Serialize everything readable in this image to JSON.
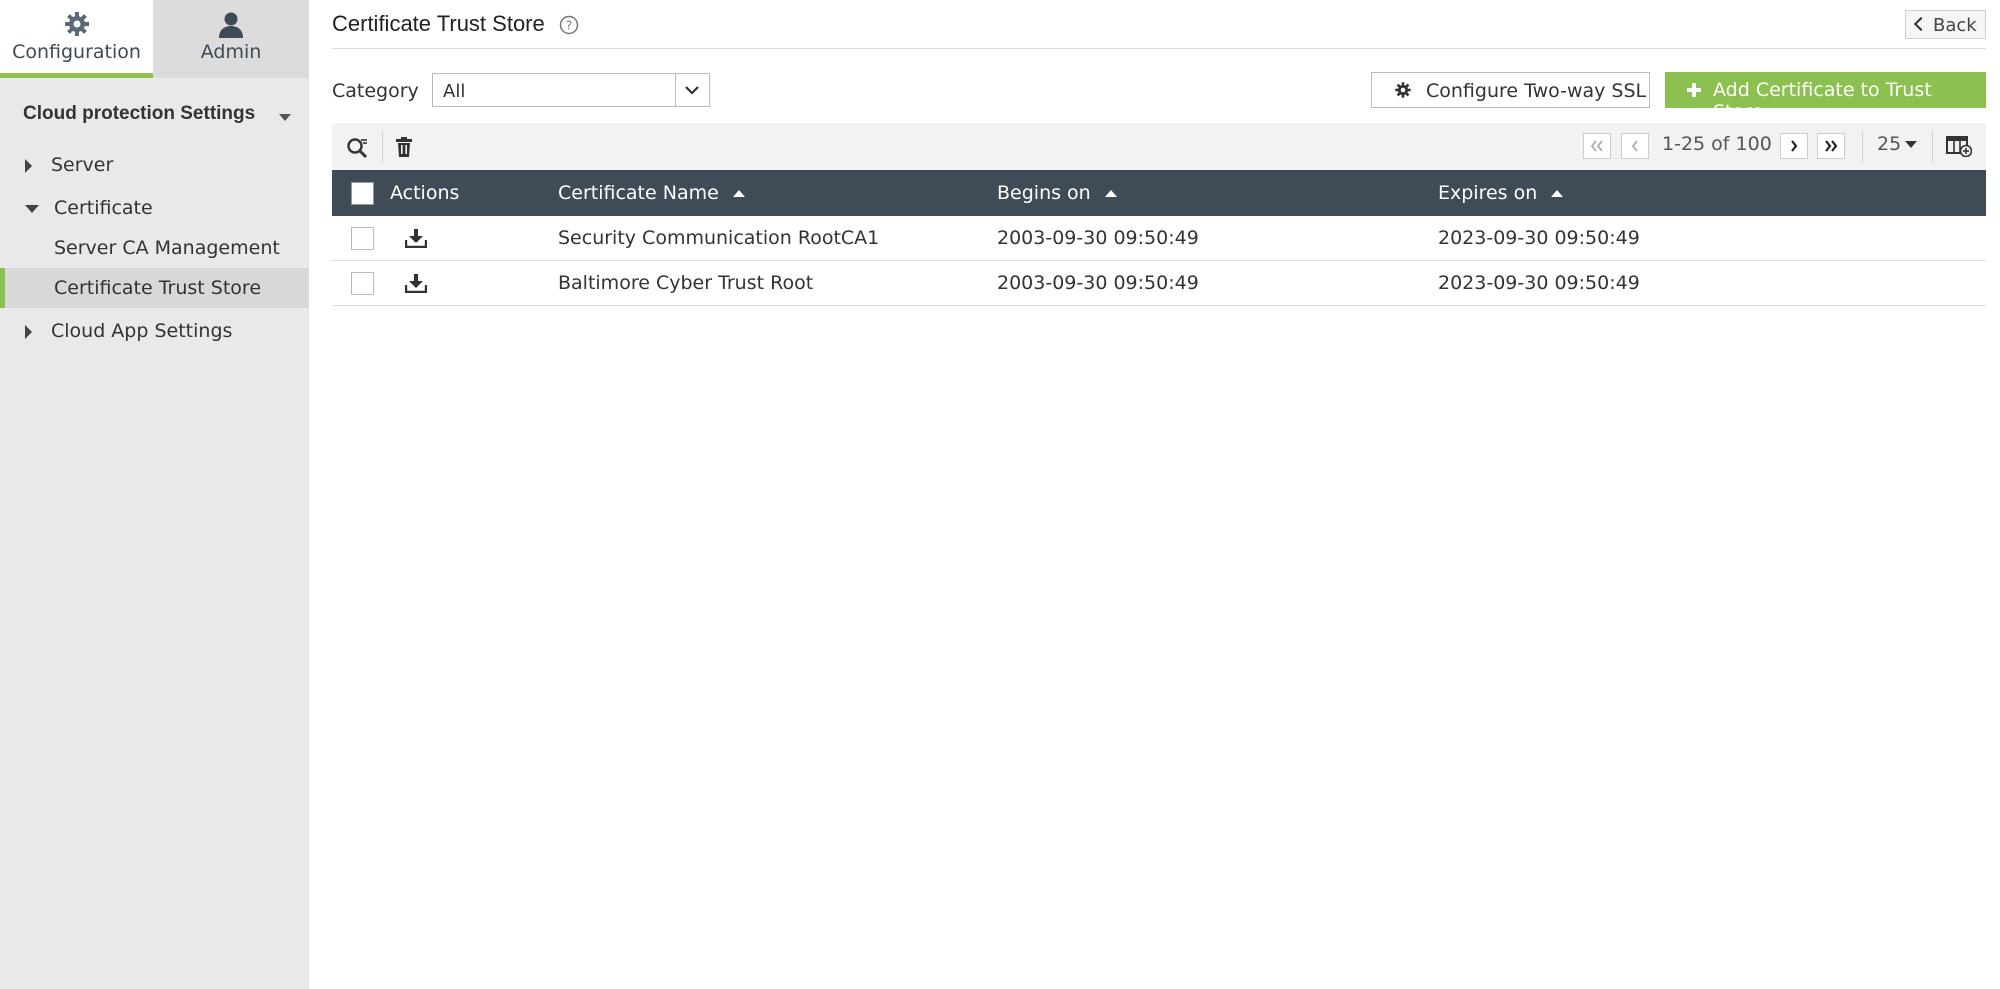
{
  "topnav": {
    "configuration_label": "Configuration",
    "admin_label": "Admin"
  },
  "sidebar": {
    "section_title": "Cloud protection Settings",
    "items": [
      {
        "label": "Server",
        "state": "collapsed"
      },
      {
        "label": "Certificate",
        "state": "expanded"
      },
      {
        "label": "Server CA Management",
        "state": "child"
      },
      {
        "label": "Certificate Trust Store",
        "state": "selected"
      },
      {
        "label": "Cloud App Settings",
        "state": "collapsed"
      }
    ]
  },
  "header": {
    "title": "Certificate Trust Store",
    "back_label": "Back"
  },
  "filters": {
    "category_label": "Category",
    "category_value": "All"
  },
  "actions": {
    "configure_ssl_label": "Configure Two-way SSL",
    "add_certificate_label": "Add Certificate to Trust Store"
  },
  "pagination": {
    "range_text": "1-25 of 100",
    "page_size": "25"
  },
  "table": {
    "columns": [
      "Actions",
      "Certificate Name",
      "Begins on",
      "Expires on"
    ],
    "rows": [
      {
        "name": "Security Communication RootCA1",
        "begins": "2003-09-30 09:50:49",
        "expires": "2023-09-30 09:50:49"
      },
      {
        "name": "Baltimore Cyber Trust Root",
        "begins": "2003-09-30 09:50:49",
        "expires": "2023-09-30 09:50:49"
      }
    ]
  },
  "colors": {
    "accent_green": "#8cc152",
    "table_header": "#3f4b57",
    "sidebar_bg": "#e9e9e9"
  }
}
